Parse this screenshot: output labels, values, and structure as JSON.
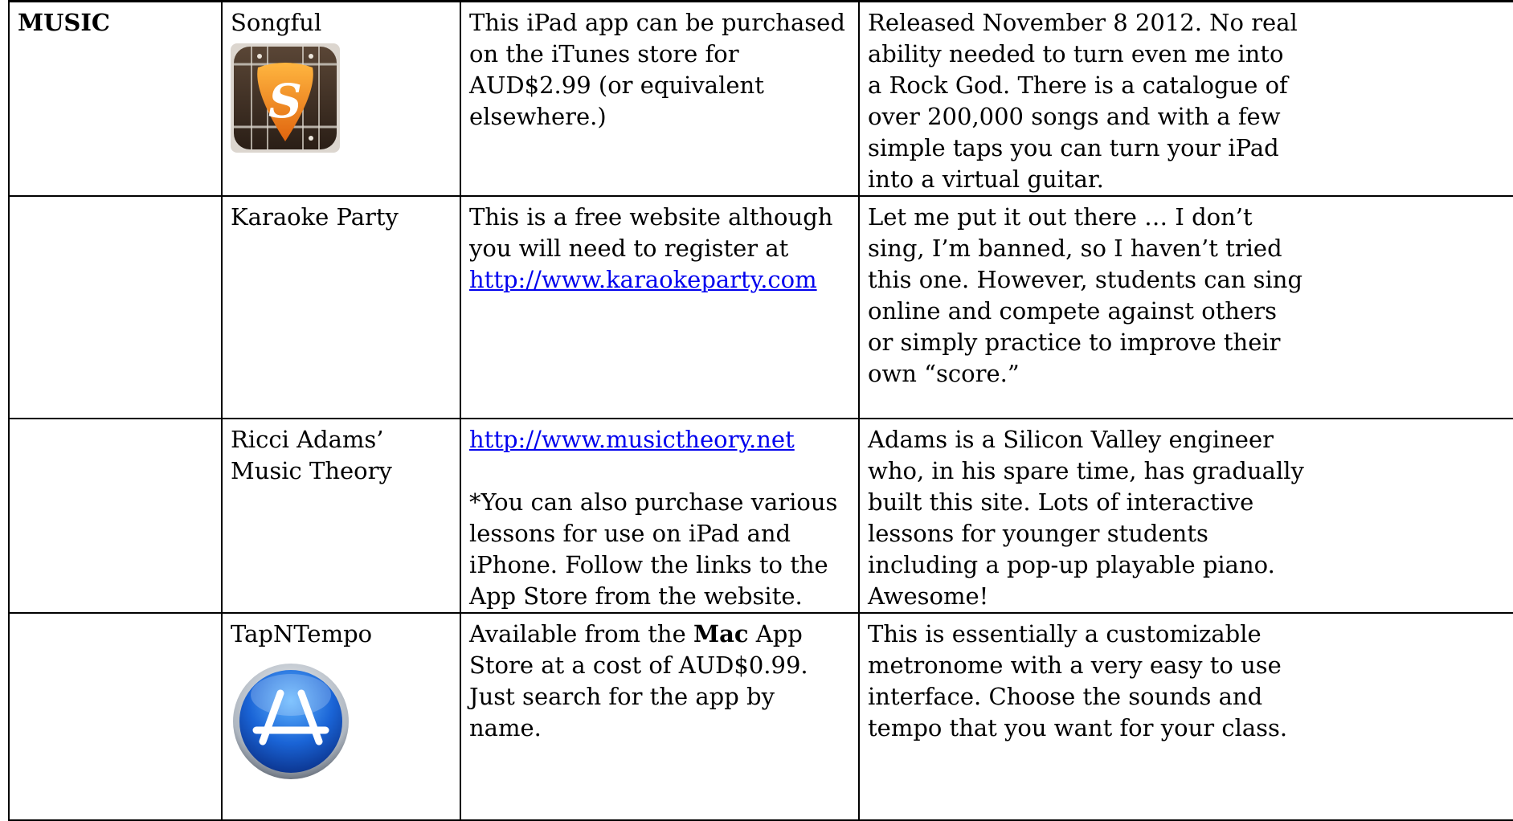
{
  "rows": [
    {
      "category": "MUSIC",
      "name": "Songful",
      "icon": "songful-guitar-pick-icon",
      "access": "This iPad app can be purchased on the iTunes store for AUD$2.99 (or equivalent elsewhere.)",
      "desc_lines": [
        "Released November 8 2012. No real",
        "ability needed to turn even me into",
        "a Rock God. There is a catalogue of",
        "over 200,000 songs and with a few",
        "simple taps you can turn your iPad",
        "into a virtual guitar."
      ]
    },
    {
      "category": "",
      "name": "Karaoke Party",
      "access": "This is a free website although you will need to register at",
      "link": "http://www.karaokeparty.com",
      "desc_lines": [
        "Let me put it out there … I don’t",
        "sing, I’m banned, so I haven’t tried",
        "this one. However, students can sing",
        "online and compete against others",
        "or simply practice to improve their",
        "own “score.”"
      ]
    },
    {
      "category": "",
      "name": "Ricci Adams’ Music Theory",
      "link": "http://www.musictheory.net",
      "access_note": "*You can also purchase various lessons for use on iPad and iPhone. Follow the links to the App Store from the website.",
      "desc_lines": [
        "Adams is a Silicon Valley engineer",
        "who, in his spare time, has gradually",
        "built this site. Lots of interactive",
        "lessons for younger students",
        "including a pop-up playable piano.",
        "Awesome!"
      ]
    },
    {
      "category": "",
      "name": "TapNTempo",
      "icon": "app-store-icon",
      "access_pre": "Available from the",
      "access_bold": "Mac",
      "access_post": "App Store at a cost of AUD$0.99. Just search for the app by name.",
      "desc_lines": [
        "This is essentially a customizable",
        "metronome with a very easy to use",
        "interface. Choose the sounds and",
        "tempo that you want for your class."
      ]
    }
  ],
  "colors": {
    "link": "#0000ee",
    "border": "#000000",
    "songful_orange": "#f0961e",
    "appstore_blue": "#1a64d6"
  }
}
